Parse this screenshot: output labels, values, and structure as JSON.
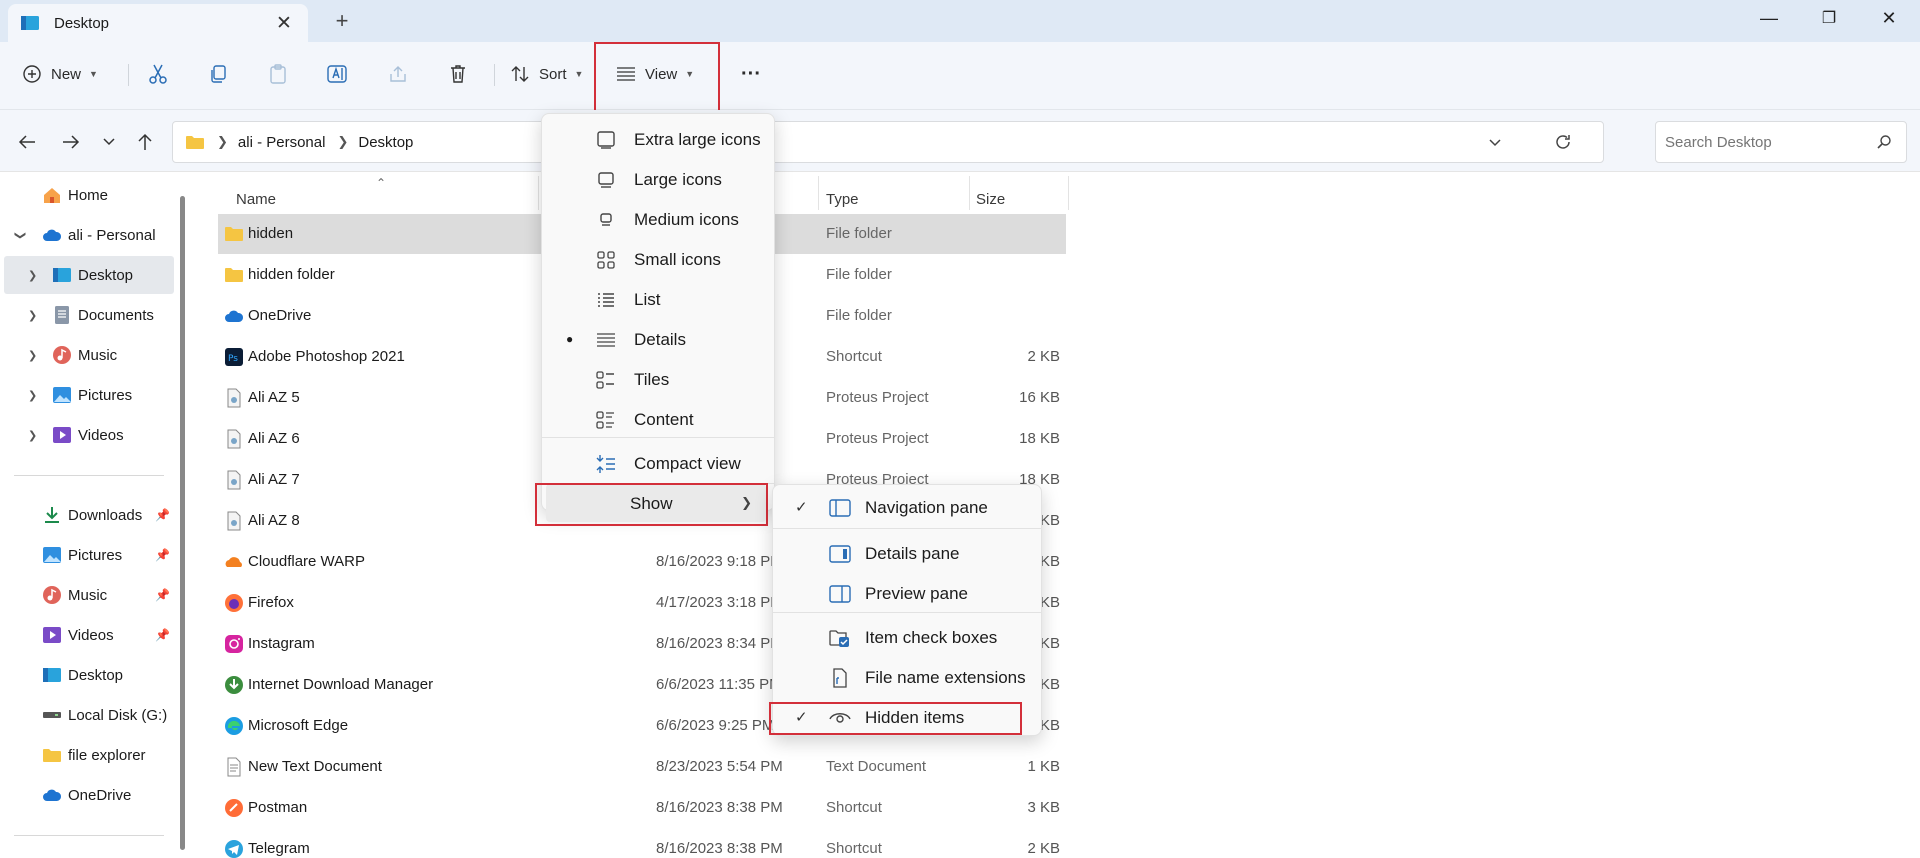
{
  "window": {
    "tab_title": "Desktop",
    "controls": {
      "minimize": "—",
      "restore": "❐",
      "close": "✕"
    }
  },
  "toolbar": {
    "new_label": "New",
    "sort_label": "Sort",
    "view_label": "View",
    "more_label": "···"
  },
  "address": {
    "crumbs": [
      "ali - Personal",
      "Desktop"
    ],
    "search_placeholder": "Search Desktop"
  },
  "sidebar": {
    "items": [
      {
        "label": "Home",
        "icon": "home-icon"
      },
      {
        "label": "ali - Personal",
        "icon": "onedrive-icon"
      },
      {
        "label": "Desktop",
        "icon": "desktop-folder-icon"
      },
      {
        "label": "Documents",
        "icon": "documents-icon"
      },
      {
        "label": "Music",
        "icon": "music-icon"
      },
      {
        "label": "Pictures",
        "icon": "pictures-icon"
      },
      {
        "label": "Videos",
        "icon": "videos-icon"
      }
    ],
    "quick": [
      {
        "label": "Downloads",
        "icon": "downloads-icon",
        "pinned": true
      },
      {
        "label": "Pictures",
        "icon": "pictures-icon",
        "pinned": true
      },
      {
        "label": "Music",
        "icon": "music-icon",
        "pinned": true
      },
      {
        "label": "Videos",
        "icon": "videos-icon",
        "pinned": true
      },
      {
        "label": "Desktop",
        "icon": "desktop-folder-icon",
        "pinned": false
      },
      {
        "label": "Local Disk (G:)",
        "icon": "drive-icon",
        "pinned": false
      },
      {
        "label": "file explorer",
        "icon": "folder-icon",
        "pinned": false
      },
      {
        "label": "OneDrive",
        "icon": "onedrive-icon",
        "pinned": false
      }
    ]
  },
  "columns": {
    "name": "Name",
    "type": "Type",
    "size": "Size"
  },
  "files": [
    {
      "name": "hidden",
      "date": "",
      "type": "File folder",
      "size": "",
      "icon": "folder-icon"
    },
    {
      "name": "hidden folder",
      "date": "",
      "type": "File folder",
      "size": "",
      "icon": "folder-icon"
    },
    {
      "name": "OneDrive",
      "date": "",
      "type": "File folder",
      "size": "",
      "icon": "onedrive-icon"
    },
    {
      "name": "Adobe Photoshop 2021",
      "date": "",
      "type": "Shortcut",
      "size": "2 KB",
      "icon": "photoshop-icon"
    },
    {
      "name": "Ali AZ 5",
      "date": "",
      "type": "Proteus Project",
      "size": "16 KB",
      "icon": "file-icon"
    },
    {
      "name": "Ali AZ 6",
      "date": "",
      "type": "Proteus Project",
      "size": "18 KB",
      "icon": "file-icon"
    },
    {
      "name": "Ali AZ 7",
      "date": "",
      "type": "Proteus Project",
      "size": "18 KB",
      "icon": "file-icon"
    },
    {
      "name": "Ali AZ 8",
      "date": "",
      "type": "",
      "size": "KB",
      "icon": "file-icon"
    },
    {
      "name": "Cloudflare WARP",
      "date": "8/16/2023 9:18 PM",
      "type": "",
      "size": "KB",
      "icon": "cloudflare-icon"
    },
    {
      "name": "Firefox",
      "date": "4/17/2023 3:18 PM",
      "type": "",
      "size": "KB",
      "icon": "firefox-icon"
    },
    {
      "name": "Instagram",
      "date": "8/16/2023 8:34 PM",
      "type": "",
      "size": "KB",
      "icon": "instagram-icon"
    },
    {
      "name": "Internet Download Manager",
      "date": "6/6/2023 11:35 PM",
      "type": "",
      "size": "KB",
      "icon": "idm-icon"
    },
    {
      "name": "Microsoft Edge",
      "date": "6/6/2023 9:25 PM",
      "type": "",
      "size": "KB",
      "icon": "edge-icon"
    },
    {
      "name": "New Text Document",
      "date": "8/23/2023 5:54 PM",
      "type": "Text Document",
      "size": "1 KB",
      "icon": "text-file-icon"
    },
    {
      "name": "Postman",
      "date": "8/16/2023 8:38 PM",
      "type": "Shortcut",
      "size": "3 KB",
      "icon": "postman-icon"
    },
    {
      "name": "Telegram",
      "date": "8/16/2023 8:38 PM",
      "type": "Shortcut",
      "size": "2 KB",
      "icon": "telegram-icon"
    }
  ],
  "view_menu": {
    "items": [
      {
        "label": "Extra large icons",
        "icon": "extra-large-icons-icon"
      },
      {
        "label": "Large icons",
        "icon": "large-icons-icon"
      },
      {
        "label": "Medium icons",
        "icon": "medium-icons-icon"
      },
      {
        "label": "Small icons",
        "icon": "small-icons-icon"
      },
      {
        "label": "List",
        "icon": "list-icon"
      },
      {
        "label": "Details",
        "icon": "details-icon",
        "selected": true
      },
      {
        "label": "Tiles",
        "icon": "tiles-icon"
      },
      {
        "label": "Content",
        "icon": "content-icon"
      }
    ],
    "compact": "Compact view",
    "show": "Show"
  },
  "show_menu": {
    "items": [
      {
        "label": "Navigation pane",
        "checked": true,
        "icon": "navigation-pane-icon"
      },
      {
        "label": "Details pane",
        "checked": false,
        "icon": "details-pane-icon"
      },
      {
        "label": "Preview pane",
        "checked": false,
        "icon": "preview-pane-icon"
      },
      {
        "label": "Item check boxes",
        "checked": false,
        "icon": "item-checkbox-icon"
      },
      {
        "label": "File name extensions",
        "checked": false,
        "icon": "file-extension-icon"
      },
      {
        "label": "Hidden items",
        "checked": true,
        "icon": "hidden-items-icon"
      }
    ]
  },
  "colors": {
    "highlight_red": "#d32f3a",
    "folder_yellow": "#f5c542",
    "onedrive_blue": "#1e74d1"
  }
}
